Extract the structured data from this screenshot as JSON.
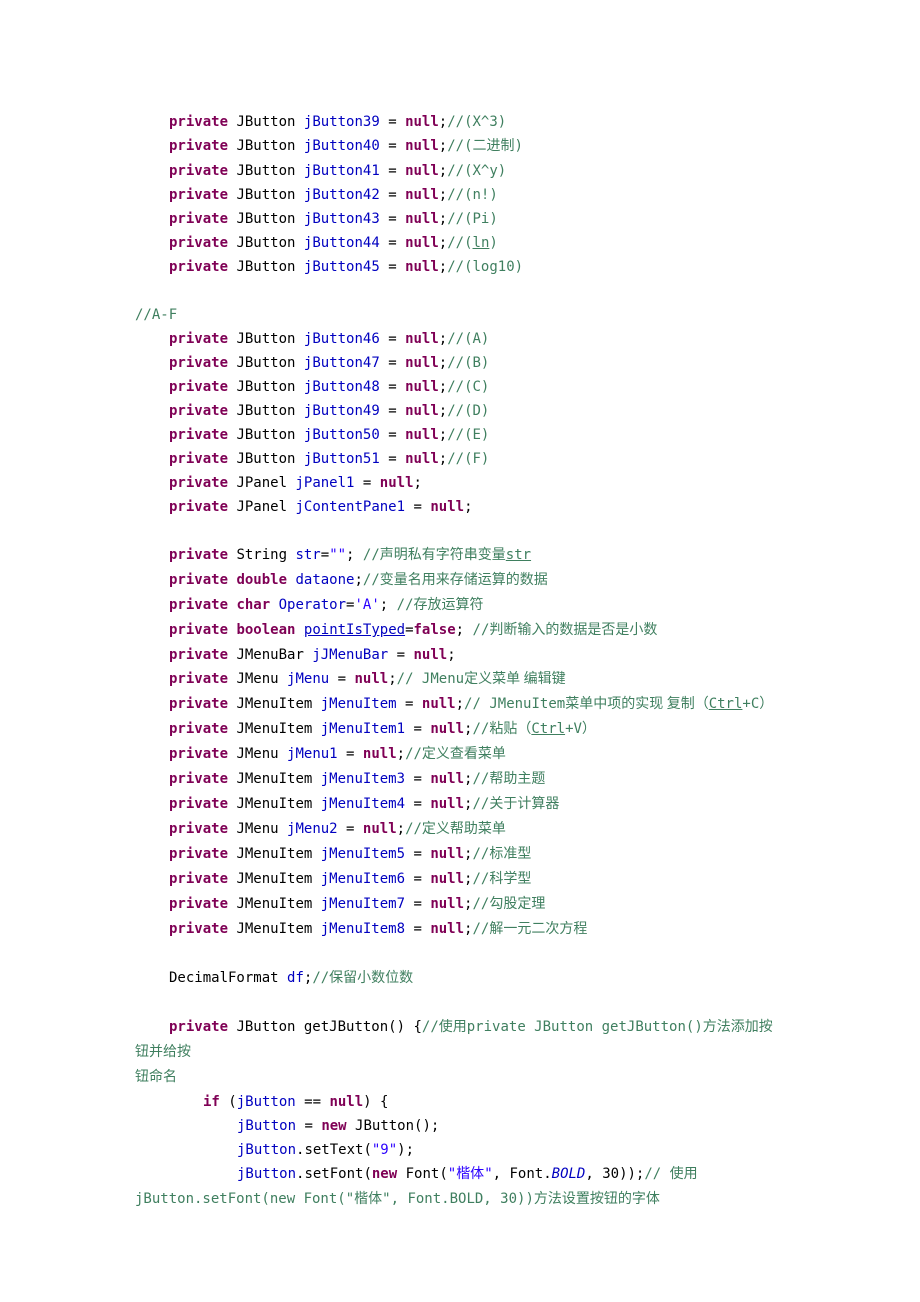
{
  "lines": [
    {
      "indent": 1,
      "kw": "private",
      "type": "JButton",
      "field": "jButton39",
      "val": "null",
      "cmt": "//(X^3)"
    },
    {
      "indent": 1,
      "kw": "private",
      "type": "JButton",
      "field": "jButton40",
      "val": "null",
      "cmt_pre": "//(",
      "cmt_cn": "二进制",
      "cmt_post": ")"
    },
    {
      "indent": 1,
      "kw": "private",
      "type": "JButton",
      "field": "jButton41",
      "val": "null",
      "cmt": "//(X^y)"
    },
    {
      "indent": 1,
      "kw": "private",
      "type": "JButton",
      "field": "jButton42",
      "val": "null",
      "cmt": "//(n!)"
    },
    {
      "indent": 1,
      "kw": "private",
      "type": "JButton",
      "field": "jButton43",
      "val": "null",
      "cmt": "//(Pi)"
    },
    {
      "indent": 1,
      "kw": "private",
      "type": "JButton",
      "field": "jButton44",
      "val": "null",
      "cmt_pre": "//(",
      "cmt_u": "ln",
      "cmt_post": ")"
    },
    {
      "indent": 1,
      "kw": "private",
      "type": "JButton",
      "field": "jButton45",
      "val": "null",
      "cmt": "//(log10)"
    },
    {
      "blank": true
    },
    {
      "raw_cmt": "//A-F"
    },
    {
      "indent": 1,
      "kw": "private",
      "type": "JButton",
      "field": "jButton46",
      "val": "null",
      "cmt": "//(A)"
    },
    {
      "indent": 1,
      "kw": "private",
      "type": "JButton",
      "field": "jButton47",
      "val": "null",
      "cmt": "//(B)"
    },
    {
      "indent": 1,
      "kw": "private",
      "type": "JButton",
      "field": "jButton48",
      "val": "null",
      "cmt": "//(C)"
    },
    {
      "indent": 1,
      "kw": "private",
      "type": "JButton",
      "field": "jButton49",
      "val": "null",
      "cmt": "//(D)"
    },
    {
      "indent": 1,
      "kw": "private",
      "type": "JButton",
      "field": "jButton50",
      "val": "null",
      "cmt": "//(E)"
    },
    {
      "indent": 1,
      "kw": "private",
      "type": "JButton",
      "field": "jButton51",
      "val": "null",
      "cmt": "//(F)"
    },
    {
      "indent": 1,
      "kw": "private",
      "type": "JPanel",
      "field": "jPanel1",
      "val": "null"
    },
    {
      "indent": 1,
      "kw": "private",
      "type": "JPanel",
      "field": "jContentPane1",
      "val": "null"
    },
    {
      "blank": true
    },
    {
      "html": "<span class='ind1'></span><span class='kw'>private</span> String <span class='fld'>str</span>=<span class='str-lit'>\"\"</span>; <span class='cmt'>//</span><span class='cmt-cn'>声明私有字符串变量</span><span class='cmt u'>str</span>"
    },
    {
      "html": "<span class='ind1'></span><span class='kw'>private</span> <span class='kw'>double</span> <span class='fld'>dataone</span>;<span class='cmt'>//</span><span class='cmt-cn'>变量名用来存储运算的数据</span>"
    },
    {
      "html": "<span class='ind1'></span><span class='kw'>private</span> <span class='kw'>char</span> <span class='fld'>Operator</span>=<span class='str-lit'>'A'</span>; <span class='cmt'>//</span><span class='cmt-cn'>存放运算符</span>"
    },
    {
      "html": "<span class='ind1'></span><span class='kw'>private</span> <span class='kw'>boolean</span> <span class='fld u'>pointIsTyped</span>=<span class='kw'>false</span>; <span class='cmt'>//</span><span class='cmt-cn'>判断输入的数据是否是小数</span>"
    },
    {
      "indent": 1,
      "kw": "private",
      "type": "JMenuBar",
      "field": "jJMenuBar",
      "val": "null"
    },
    {
      "html": "<span class='ind1'></span><span class='kw'>private</span> JMenu <span class='fld'>jMenu</span> = <span class='kw'>null</span>;<span class='cmt'>// JMenu</span><span class='cmt-cn'>定义菜单 编辑键</span>"
    },
    {
      "html": "<span class='ind1'></span><span class='kw'>private</span> JMenuItem <span class='fld'>jMenuItem</span> = <span class='kw'>null</span>;<span class='cmt'>// JMenuItem</span><span class='cmt-cn'>菜单中项的实现 复制（</span><span class='cmt u'>Ctrl</span><span class='cmt'>+C</span><span class='cmt-cn'>）</span>"
    },
    {
      "html": "<span class='ind1'></span><span class='kw'>private</span> JMenuItem <span class='fld'>jMenuItem1</span> = <span class='kw'>null</span>;<span class='cmt'>//</span><span class='cmt-cn'>粘贴（</span><span class='cmt u'>Ctrl</span><span class='cmt'>+V</span><span class='cmt-cn'>）</span>"
    },
    {
      "html": "<span class='ind1'></span><span class='kw'>private</span> JMenu <span class='fld'>jMenu1</span> = <span class='kw'>null</span>;<span class='cmt'>//</span><span class='cmt-cn'>定义查看菜单</span>"
    },
    {
      "html": "<span class='ind1'></span><span class='kw'>private</span> JMenuItem <span class='fld'>jMenuItem3</span> = <span class='kw'>null</span>;<span class='cmt'>//</span><span class='cmt-cn'>帮助主题</span>"
    },
    {
      "html": "<span class='ind1'></span><span class='kw'>private</span> JMenuItem <span class='fld'>jMenuItem4</span> = <span class='kw'>null</span>;<span class='cmt'>//</span><span class='cmt-cn'>关于计算器</span>"
    },
    {
      "html": "<span class='ind1'></span><span class='kw'>private</span> JMenu <span class='fld'>jMenu2</span> = <span class='kw'>null</span>;<span class='cmt'>//</span><span class='cmt-cn'>定义帮助菜单</span>"
    },
    {
      "html": "<span class='ind1'></span><span class='kw'>private</span> JMenuItem <span class='fld'>jMenuItem5</span> = <span class='kw'>null</span>;<span class='cmt'>//</span><span class='cmt-cn'>标准型</span>"
    },
    {
      "html": "<span class='ind1'></span><span class='kw'>private</span> JMenuItem <span class='fld'>jMenuItem6</span> = <span class='kw'>null</span>;<span class='cmt'>//</span><span class='cmt-cn'>科学型</span>"
    },
    {
      "html": "<span class='ind1'></span><span class='kw'>private</span> JMenuItem <span class='fld'>jMenuItem7</span> = <span class='kw'>null</span>;<span class='cmt'>//</span><span class='cmt-cn'>勾股定理</span>"
    },
    {
      "html": "<span class='ind1'></span><span class='kw'>private</span> JMenuItem <span class='fld'>jMenuItem8</span> = <span class='kw'>null</span>;<span class='cmt'>//</span><span class='cmt-cn'>解一元二次方程</span>"
    },
    {
      "blank": true
    },
    {
      "html": "<span class='ind1'></span>DecimalFormat <span class='fld'>df</span>;<span class='cmt'>//</span><span class='cmt-cn'>保留小数位数</span>"
    },
    {
      "blank": true
    },
    {
      "html": "<span class='ind1'></span><span class='kw'>private</span> JButton getJButton() {<span class='cmt'>//</span><span class='cmt-cn'>使用</span><span class='cmt'>private JButton getJButton()</span><span class='cmt-cn'>方法添加按钮并给按</span>"
    },
    {
      "html": "<span class='cmt-cn'>钮命名</span>"
    },
    {
      "html": "<span class='ind2'></span><span class='kw'>if</span> (<span class='fld'>jButton</span> == <span class='kw'>null</span>) {"
    },
    {
      "html": "<span class='ind3'></span><span class='fld'>jButton</span> = <span class='kw'>new</span> JButton();"
    },
    {
      "html": "<span class='ind3'></span><span class='fld'>jButton</span>.setText(<span class='str-lit'>\"9\"</span>);"
    },
    {
      "html": "<span class='ind3'></span><span class='fld'>jButton</span>.setFont(<span class='kw'>new</span> Font(<span class='str-lit'>\"</span><span class='str-lit' style=\"font-family:SimSun,serif\">楷体</span><span class='str-lit'>\"</span>, Font.<span class='static-ref'>BOLD</span>, 30));<span class='cmt'>// </span><span class='cmt-cn'>使用</span>"
    },
    {
      "html": "<span class='cmt'>jButton.setFont(new Font(\"</span><span class='cmt-cn'>楷体</span><span class='cmt'>\", Font.BOLD, 30))</span><span class='cmt-cn'>方法设置按钮的字体</span>"
    }
  ]
}
